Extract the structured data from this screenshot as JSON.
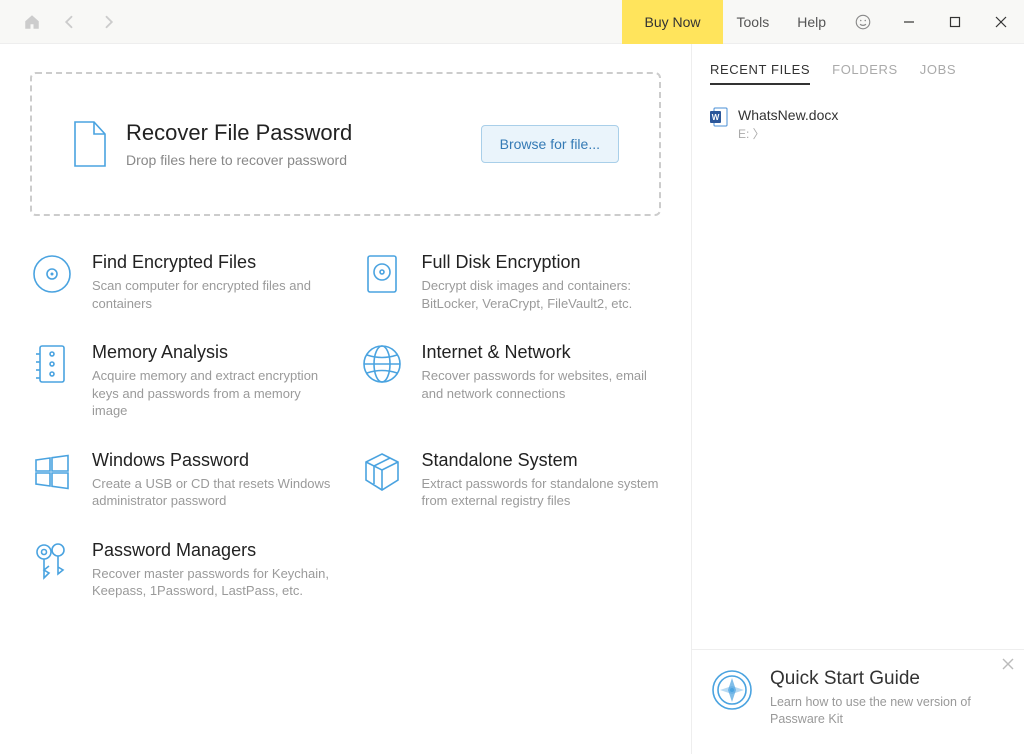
{
  "titlebar": {
    "buy_label": "Buy Now",
    "menu_tools": "Tools",
    "menu_help": "Help"
  },
  "dropzone": {
    "title": "Recover File Password",
    "subtitle": "Drop files here to recover password",
    "browse_label": "Browse for file..."
  },
  "tools": [
    {
      "title": "Find Encrypted Files",
      "desc": "Scan computer for encrypted files and containers"
    },
    {
      "title": "Full Disk Encryption",
      "desc": "Decrypt disk images and containers: BitLocker, VeraCrypt, FileVault2, etc."
    },
    {
      "title": "Memory Analysis",
      "desc": "Acquire memory and extract encryption keys and passwords from a memory image"
    },
    {
      "title": "Internet & Network",
      "desc": "Recover passwords for websites, email and network connections"
    },
    {
      "title": "Windows Password",
      "desc": "Create a USB or CD that resets Windows administrator password"
    },
    {
      "title": "Standalone System",
      "desc": "Extract passwords for standalone system from external registry files"
    },
    {
      "title": "Password Managers",
      "desc": "Recover master passwords for Keychain, Keepass, 1Password, LastPass, etc."
    }
  ],
  "sidebar": {
    "tabs": {
      "recent": "RECENT FILES",
      "folders": "FOLDERS",
      "jobs": "JOBS"
    },
    "recent": [
      {
        "name": "WhatsNew.docx",
        "path": "E: 〉"
      }
    ]
  },
  "quickstart": {
    "title": "Quick Start Guide",
    "desc": "Learn how to use the new version of Passware Kit"
  }
}
